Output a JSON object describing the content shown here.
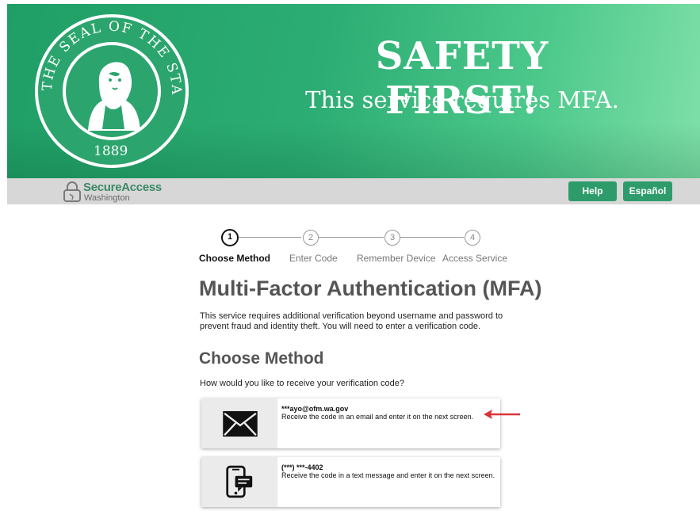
{
  "hero": {
    "title": "SAFETY FIRST!",
    "subtitle": "This service requires MFA.",
    "seal": {
      "top_text": "THE SEAL OF THE STATE OF WASHINGTON",
      "year": "1889"
    }
  },
  "header": {
    "logo_name": "SecureAccess",
    "logo_sub": "Washington",
    "help_label": "Help",
    "espanol_label": "Español"
  },
  "stepper": {
    "steps": [
      {
        "number": "1",
        "label": "Choose Method"
      },
      {
        "number": "2",
        "label": "Enter Code"
      },
      {
        "number": "3",
        "label": "Remember Device"
      },
      {
        "number": "4",
        "label": "Access Service"
      }
    ],
    "active_index": 0
  },
  "main": {
    "title": "Multi-Factor Authentication (MFA)",
    "intro": "This service requires additional verification beyond username and password to prevent fraud and identity theft. You will need to enter a verification code.",
    "section_title": "Choose Method",
    "question": "How would you like to receive your verification code?",
    "methods": [
      {
        "icon": "envelope-icon",
        "target": "***ayo@ofm.wa.gov",
        "description": "Receive the code in an email and enter it on the next screen."
      },
      {
        "icon": "phone-message-icon",
        "target": "(***) ***-4402",
        "description": "Receive the code in a text message and enter it on the next screen."
      }
    ]
  },
  "colors": {
    "brand_green": "#2e9c6a",
    "bar_grey": "#d7d7d7",
    "annotation_red": "#d9343a"
  }
}
